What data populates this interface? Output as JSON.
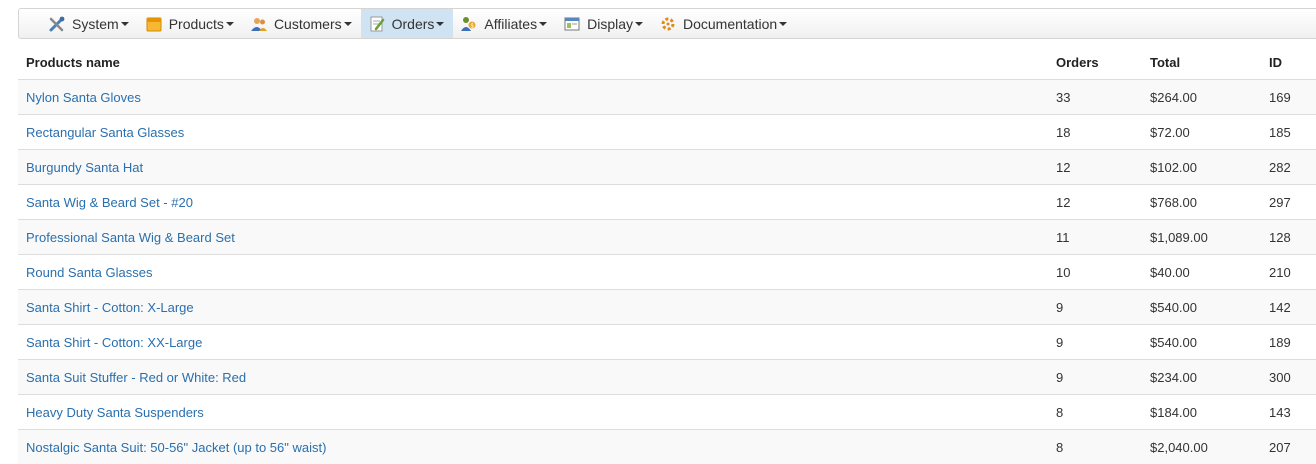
{
  "nav": {
    "items": [
      {
        "label": "System",
        "icon": "tools-icon",
        "active": false
      },
      {
        "label": "Products",
        "icon": "box-icon",
        "active": false
      },
      {
        "label": "Customers",
        "icon": "users-icon",
        "active": false
      },
      {
        "label": "Orders",
        "icon": "order-form-icon",
        "active": true
      },
      {
        "label": "Affiliates",
        "icon": "affiliates-icon",
        "active": false
      },
      {
        "label": "Display",
        "icon": "display-icon",
        "active": false
      },
      {
        "label": "Documentation",
        "icon": "documentation-icon",
        "active": false
      }
    ]
  },
  "table": {
    "headers": {
      "name": "Products name",
      "orders": "Orders",
      "total": "Total",
      "id": "ID"
    },
    "rows": [
      {
        "name": "Nylon Santa Gloves",
        "orders": "33",
        "total": "$264.00",
        "id": "169"
      },
      {
        "name": "Rectangular Santa Glasses",
        "orders": "18",
        "total": "$72.00",
        "id": "185"
      },
      {
        "name": "Burgundy Santa Hat",
        "orders": "12",
        "total": "$102.00",
        "id": "282"
      },
      {
        "name": "Santa Wig & Beard Set - #20",
        "orders": "12",
        "total": "$768.00",
        "id": "297"
      },
      {
        "name": "Professional Santa Wig & Beard Set",
        "orders": "11",
        "total": "$1,089.00",
        "id": "128"
      },
      {
        "name": "Round Santa Glasses",
        "orders": "10",
        "total": "$40.00",
        "id": "210"
      },
      {
        "name": "Santa Shirt - Cotton: X-Large",
        "orders": "9",
        "total": "$540.00",
        "id": "142"
      },
      {
        "name": "Santa Shirt - Cotton: XX-Large",
        "orders": "9",
        "total": "$540.00",
        "id": "189"
      },
      {
        "name": "Santa Suit Stuffer - Red or White: Red",
        "orders": "9",
        "total": "$234.00",
        "id": "300"
      },
      {
        "name": "Heavy Duty Santa Suspenders",
        "orders": "8",
        "total": "$184.00",
        "id": "143"
      },
      {
        "name": "Nostalgic Santa Suit: 50-56\" Jacket (up to 56\" waist)",
        "orders": "8",
        "total": "$2,040.00",
        "id": "207"
      }
    ]
  }
}
